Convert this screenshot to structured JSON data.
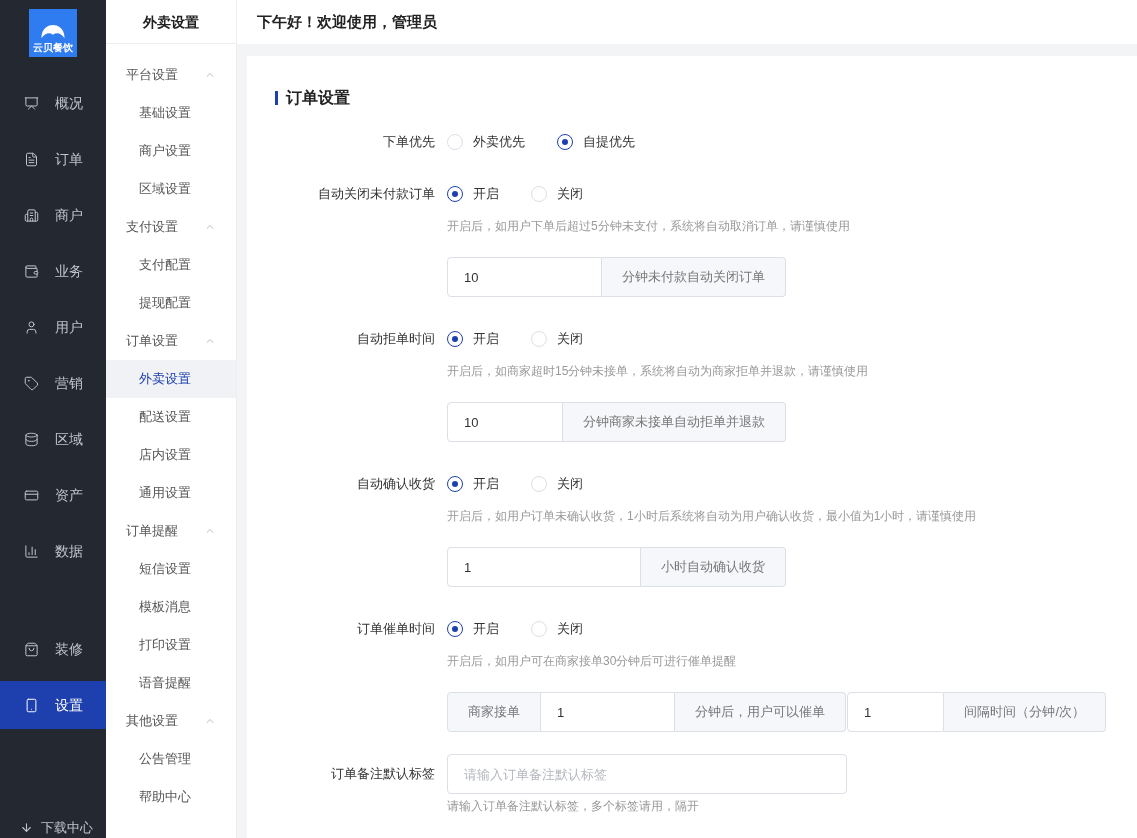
{
  "sidebar": {
    "logo_text": "云贝餐饮",
    "items": [
      {
        "label": "概况",
        "selected": false
      },
      {
        "label": "订单",
        "selected": false
      },
      {
        "label": "商户",
        "selected": false
      },
      {
        "label": "业务",
        "selected": false
      },
      {
        "label": "用户",
        "selected": false
      },
      {
        "label": "营销",
        "selected": false
      },
      {
        "label": "区域",
        "selected": false
      },
      {
        "label": "资产",
        "selected": false
      },
      {
        "label": "数据",
        "selected": false
      }
    ],
    "lower_items": [
      {
        "label": "装修",
        "selected": false
      },
      {
        "label": "设置",
        "selected": true
      }
    ],
    "footer": "下载中心"
  },
  "submenu": {
    "title": "外卖设置",
    "groups": [
      {
        "label": "平台设置",
        "expanded": true,
        "children": [
          {
            "label": "基础设置",
            "selected": false
          },
          {
            "label": "商户设置",
            "selected": false
          },
          {
            "label": "区域设置",
            "selected": false
          }
        ]
      },
      {
        "label": "支付设置",
        "expanded": true,
        "children": [
          {
            "label": "支付配置",
            "selected": false
          },
          {
            "label": "提现配置",
            "selected": false
          }
        ]
      },
      {
        "label": "订单设置",
        "expanded": true,
        "children": [
          {
            "label": "外卖设置",
            "selected": true
          },
          {
            "label": "配送设置",
            "selected": false
          },
          {
            "label": "店内设置",
            "selected": false
          },
          {
            "label": "通用设置",
            "selected": false
          }
        ]
      },
      {
        "label": "订单提醒",
        "expanded": true,
        "children": [
          {
            "label": "短信设置",
            "selected": false
          },
          {
            "label": "模板消息",
            "selected": false
          },
          {
            "label": "打印设置",
            "selected": false
          },
          {
            "label": "语音提醒",
            "selected": false
          }
        ]
      },
      {
        "label": "其他设置",
        "expanded": true,
        "children": [
          {
            "label": "公告管理",
            "selected": false
          },
          {
            "label": "帮助中心",
            "selected": false
          }
        ]
      }
    ]
  },
  "header": {
    "greeting": "下午好！欢迎使用，管理员"
  },
  "section_title": "订单设置",
  "settings": [
    {
      "kind": "radio",
      "label": "下单优先",
      "options": [
        {
          "label": "外卖优先",
          "selected": false
        },
        {
          "label": "自提优先",
          "selected": true
        }
      ]
    },
    {
      "kind": "radio",
      "label": "自动关闭未付款订单",
      "options": [
        {
          "label": "开启",
          "selected": true
        },
        {
          "label": "关闭",
          "selected": false
        }
      ],
      "hint": "开启后，如用户下单后超过5分钟未支付，系统将自动取消订单，请谨慎使用",
      "groups": [
        [
          {
            "kind": "input",
            "value": "10"
          },
          {
            "kind": "addon",
            "text": "分钟未付款自动关闭订单"
          }
        ]
      ]
    },
    {
      "kind": "radio",
      "label": "自动拒单时间",
      "options": [
        {
          "label": "开启",
          "selected": true
        },
        {
          "label": "关闭",
          "selected": false
        }
      ],
      "hint": "开启后，如商家超时15分钟未接单，系统将自动为商家拒单并退款，请谨慎使用",
      "groups": [
        [
          {
            "kind": "input",
            "value": "10"
          },
          {
            "kind": "addon",
            "text": "分钟商家未接单自动拒单并退款"
          }
        ]
      ]
    },
    {
      "kind": "radio",
      "label": "自动确认收货",
      "options": [
        {
          "label": "开启",
          "selected": true
        },
        {
          "label": "关闭",
          "selected": false
        }
      ],
      "hint": "开启后，如用户订单未确认收货，1小时后系统将自动为用户确认收货，最小值为1小时，请谨慎使用",
      "groups": [
        [
          {
            "kind": "input",
            "value": "1"
          },
          {
            "kind": "addon",
            "text": "小时自动确认收货"
          }
        ]
      ]
    },
    {
      "kind": "radio",
      "label": "订单催单时间",
      "options": [
        {
          "label": "开启",
          "selected": true
        },
        {
          "label": "关闭",
          "selected": false
        }
      ],
      "hint": "开启后，如用户可在商家接单30分钟后可进行催单提醒",
      "groups": [
        [
          {
            "kind": "addon",
            "text": "商家接单"
          },
          {
            "kind": "input",
            "value": "1"
          },
          {
            "kind": "addon",
            "text": "分钟后，用户可以催单"
          }
        ],
        [
          {
            "kind": "input",
            "value": "1"
          },
          {
            "kind": "addon",
            "text": "间隔时间（分钟/次）"
          }
        ]
      ]
    },
    {
      "kind": "text",
      "label": "订单备注默认标签",
      "placeholder": "请输入订单备注默认标签",
      "hint": "请输入订单备注默认标签，多个标签请用，隔开"
    }
  ]
}
